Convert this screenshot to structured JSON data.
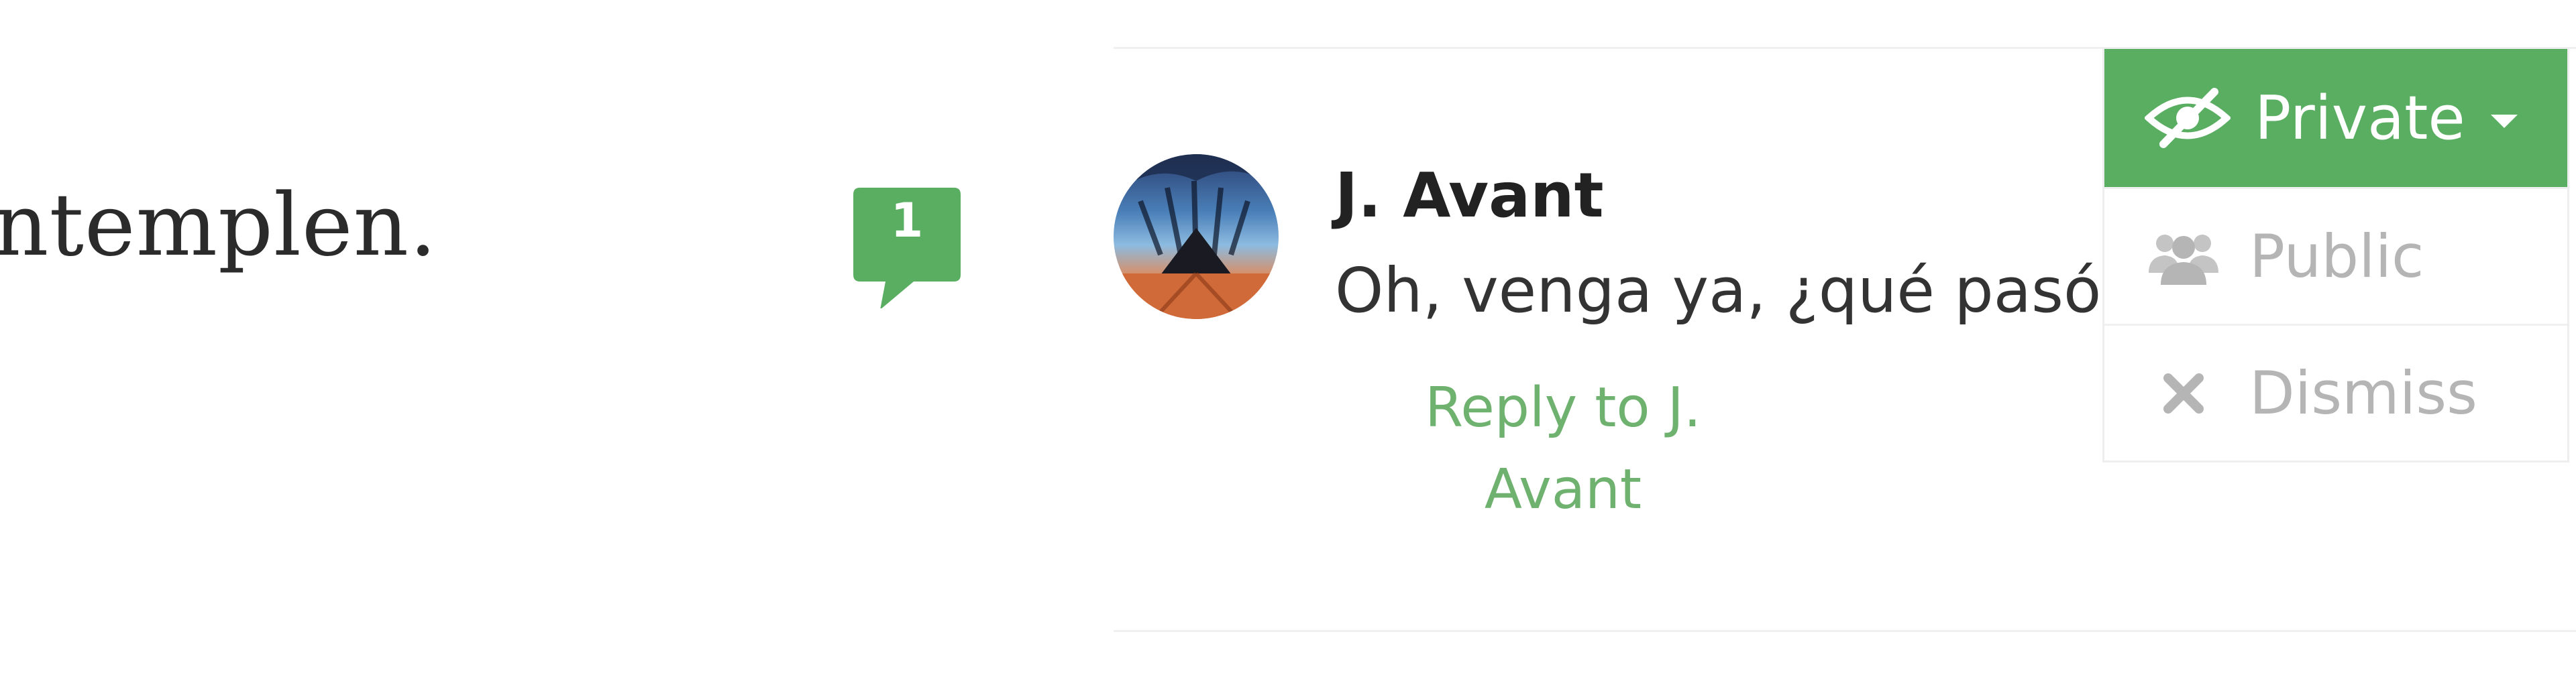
{
  "article": {
    "text_fragment": "ntemplen."
  },
  "comment_badge": {
    "count": "1",
    "color": "#5aae62"
  },
  "comment": {
    "author": "J. Avant",
    "text": "Oh, venga ya, ¿qué pasó",
    "reply_label": "Reply to J. Avant",
    "avatar_icon": "avatar-landscape-icon"
  },
  "visibility_menu": {
    "selected": {
      "label": "Private",
      "icon": "eye-slash-icon"
    },
    "options": [
      {
        "label": "Public",
        "icon": "users-icon"
      },
      {
        "label": "Dismiss",
        "icon": "close-icon"
      }
    ],
    "accent_color": "#5aae62",
    "muted_color": "#b5b5b5"
  }
}
